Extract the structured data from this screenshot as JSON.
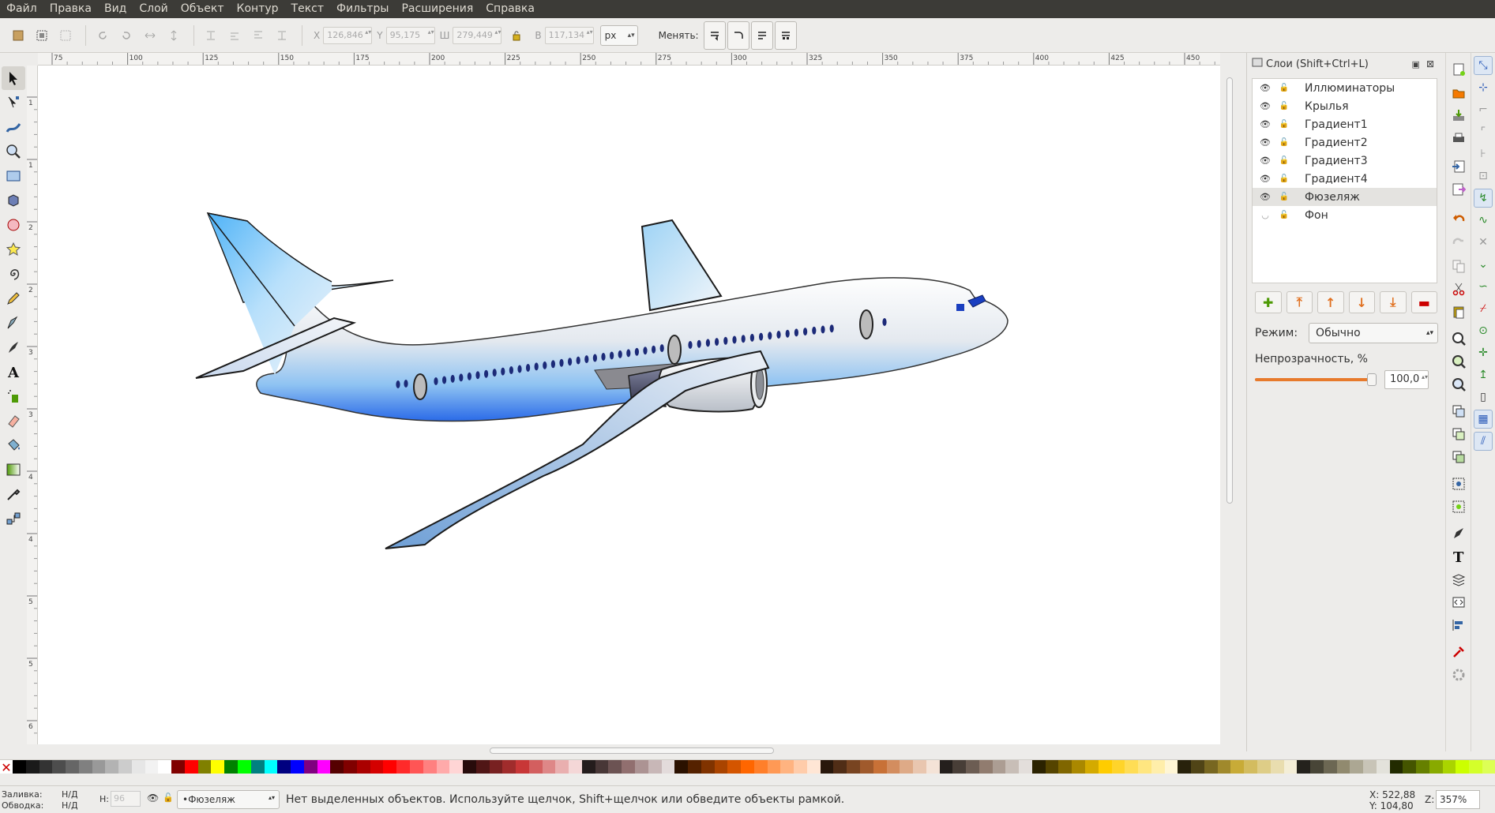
{
  "menu": [
    "Файл",
    "Правка",
    "Вид",
    "Слой",
    "Объект",
    "Контур",
    "Текст",
    "Фильтры",
    "Расширения",
    "Справка"
  ],
  "toolbar": {
    "x_label": "X",
    "x_value": "126,846",
    "y_label": "Y",
    "y_value": "95,175",
    "w_label": "Ш",
    "w_value": "279,449",
    "h_label": "В",
    "h_value": "117,134",
    "unit": "px",
    "transform_label": "Менять:"
  },
  "ruler": {
    "top": [
      "75",
      "100",
      "125",
      "150",
      "175",
      "200",
      "225",
      "250",
      "275",
      "300",
      "325",
      "350",
      "375",
      "400",
      "425",
      "450"
    ],
    "left": [
      "1",
      "1",
      "2",
      "2",
      "3",
      "3",
      "4",
      "4",
      "5",
      "5",
      "6"
    ]
  },
  "layers_panel": {
    "title": "Слои (Shift+Ctrl+L)",
    "layers": [
      {
        "name": "Иллюминаторы",
        "visible": true
      },
      {
        "name": "Крылья",
        "visible": true
      },
      {
        "name": "Градиент1",
        "visible": true
      },
      {
        "name": "Градиент2",
        "visible": true
      },
      {
        "name": "Градиент3",
        "visible": true
      },
      {
        "name": "Градиент4",
        "visible": true
      },
      {
        "name": "Фюзеляж",
        "visible": true,
        "selected": true
      },
      {
        "name": "Фон",
        "visible": false
      }
    ],
    "mode_label": "Режим:",
    "mode_value": "Обычно",
    "opacity_label": "Непрозрачность, %",
    "opacity_value": "100,0"
  },
  "palette": [
    "#000000",
    "#1a1a1a",
    "#333333",
    "#4d4d4d",
    "#666666",
    "#808080",
    "#999999",
    "#b3b3b3",
    "#cccccc",
    "#e6e6e6",
    "#f2f2f2",
    "#ffffff",
    "#800000",
    "#ff0000",
    "#808000",
    "#ffff00",
    "#008000",
    "#00ff00",
    "#008080",
    "#00ffff",
    "#000080",
    "#0000ff",
    "#800080",
    "#ff00ff",
    "#550000",
    "#800000",
    "#aa0000",
    "#d40000",
    "#ff0000",
    "#ff2a2a",
    "#ff5555",
    "#ff8080",
    "#ffaaaa",
    "#ffd5d5",
    "#280b0b",
    "#501616",
    "#782121",
    "#a02c2c",
    "#c83737",
    "#d35f5f",
    "#de8787",
    "#e9afaf",
    "#f4d7d7",
    "#241c1c",
    "#483737",
    "#6c5353",
    "#916f6f",
    "#ac9393",
    "#c8b7b7",
    "#e3dbdb",
    "#2b1100",
    "#552200",
    "#803300",
    "#aa4400",
    "#d45500",
    "#ff6600",
    "#ff7f2a",
    "#ff9955",
    "#ffb380",
    "#ffccaa",
    "#ffe6d5",
    "#28170b",
    "#502d16",
    "#784421",
    "#a05a2c",
    "#c87137",
    "#d38d5f",
    "#deaa87",
    "#e9c6af",
    "#f4e3d7",
    "#241f1c",
    "#483e37",
    "#6c5d53",
    "#917c6f",
    "#ac9d93",
    "#c8beb7",
    "#e3dedb",
    "#2b2200",
    "#554400",
    "#806600",
    "#aa8800",
    "#d4aa00",
    "#ffcc00",
    "#ffd42a",
    "#ffdd55",
    "#ffe680",
    "#ffeeaa",
    "#fff6d5",
    "#28220b",
    "#504416",
    "#786721",
    "#a0892c",
    "#c8ab37",
    "#d3bc5f",
    "#decd87",
    "#e9ddaf",
    "#f4eed7",
    "#24221c",
    "#484537",
    "#6c6753",
    "#918a6f",
    "#aca793",
    "#c8c4b7",
    "#e3e2db",
    "#222b00",
    "#445500",
    "#668000",
    "#88aa00",
    "#aad400",
    "#ccff00",
    "#d4ff2a",
    "#ddff55"
  ],
  "status": {
    "fill_label": "Заливка:",
    "stroke_label": "Обводка:",
    "fill_value": "Н/Д",
    "stroke_value": "Н/Д",
    "h_label": "Н:",
    "h_value": "96",
    "current_layer": "•Фюзеляж",
    "message": "Нет выделенных объектов. Используйте щелчок, Shift+щелчок или обведите объекты рамкой.",
    "x_label": "X:",
    "x_value": "522,88",
    "y_label": "Y:",
    "y_value": "104,80",
    "zoom_label": "Z:",
    "zoom_value": "357%"
  },
  "icons": {
    "tools": [
      "selector-icon",
      "node-icon",
      "tweak-icon",
      "zoom-icon",
      "rectangle-icon",
      "box3d-icon",
      "ellipse-icon",
      "star-icon",
      "spiral-icon",
      "pencil-icon",
      "pen-icon",
      "calligraphy-icon",
      "text-icon",
      "spray-icon",
      "eraser-icon",
      "bucket-icon",
      "gradient-icon",
      "dropper-icon",
      "connector-icon"
    ]
  }
}
